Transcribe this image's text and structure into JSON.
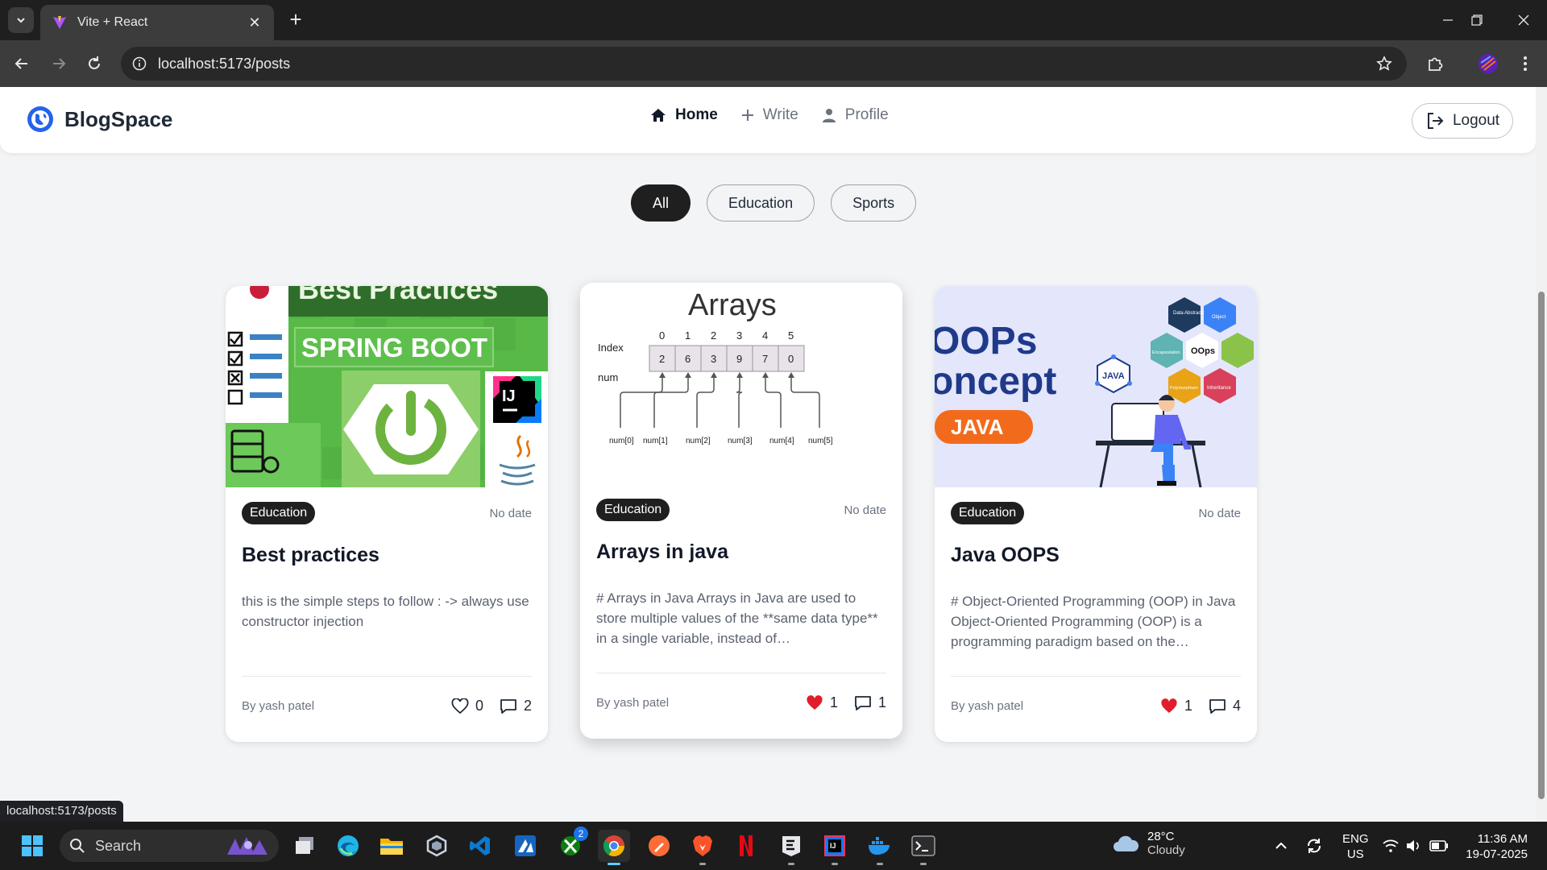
{
  "browser": {
    "tab_title": "Vite + React",
    "url": "localhost:5173/posts",
    "status_url": "localhost:5173/posts"
  },
  "app": {
    "brand": "BlogSpace",
    "nav": [
      {
        "label": "Home",
        "icon": "home-icon",
        "active": true
      },
      {
        "label": "Write",
        "icon": "plus-icon",
        "active": false
      },
      {
        "label": "Profile",
        "icon": "user-icon",
        "active": false
      }
    ],
    "logout_label": "Logout",
    "filters": [
      "All",
      "Education",
      "Sports"
    ],
    "active_filter": "All"
  },
  "posts": [
    {
      "category": "Education",
      "date": "No date",
      "title": "Best practices",
      "excerpt": "this is the simple steps to follow : -> always use constructor injection",
      "author": "By yash patel",
      "likes": "0",
      "liked": false,
      "comments": "2",
      "image": {
        "heading": "Best Practices",
        "banner": "SPRING BOOT",
        "ide_badge": "IJ"
      }
    },
    {
      "category": "Education",
      "date": "No date",
      "title": "Arrays in java",
      "excerpt": "# Arrays in Java Arrays in Java are used to store multiple values of the **same data type** in a single variable, instead of…",
      "author": "By yash patel",
      "likes": "1",
      "liked": true,
      "comments": "1",
      "image": {
        "heading": "Arrays",
        "index_label": "Index",
        "num_label": "num",
        "indices": [
          "0",
          "1",
          "2",
          "3",
          "4",
          "5"
        ],
        "values": [
          "2",
          "6",
          "3",
          "9",
          "7",
          "0"
        ],
        "refs": [
          "num[0]",
          "num[1]",
          "num[2]",
          "num[3]",
          "num[4]",
          "num[5]"
        ]
      }
    },
    {
      "category": "Education",
      "date": "No date",
      "title": "Java OOPS",
      "excerpt": "# Object-Oriented Programming (OOP) in Java Object-Oriented Programming (OOP) is a programming paradigm based on the…",
      "author": "By yash patel",
      "likes": "1",
      "liked": true,
      "comments": "4",
      "image": {
        "line1": "OOPs",
        "line2": "oncept",
        "pill": "JAVA",
        "hex_center": "OOps",
        "hex_labels": [
          "Data Abstraction",
          "Object",
          "Encapsulation",
          "Polymorphism",
          "Inheritance"
        ],
        "badge": "JAVA"
      }
    }
  ],
  "taskbar": {
    "search_placeholder": "Search",
    "badge_count": "2",
    "weather_temp": "28°C",
    "weather_cond": "Cloudy",
    "lang_line1": "ENG",
    "lang_line2": "US",
    "time": "11:36 AM",
    "date": "19-07-2025"
  },
  "colors": {
    "accent_dark": "#1f1f1f",
    "like_red": "#e11d2b",
    "spring_green": "#6db33f",
    "oops_orange": "#f26b1d"
  }
}
